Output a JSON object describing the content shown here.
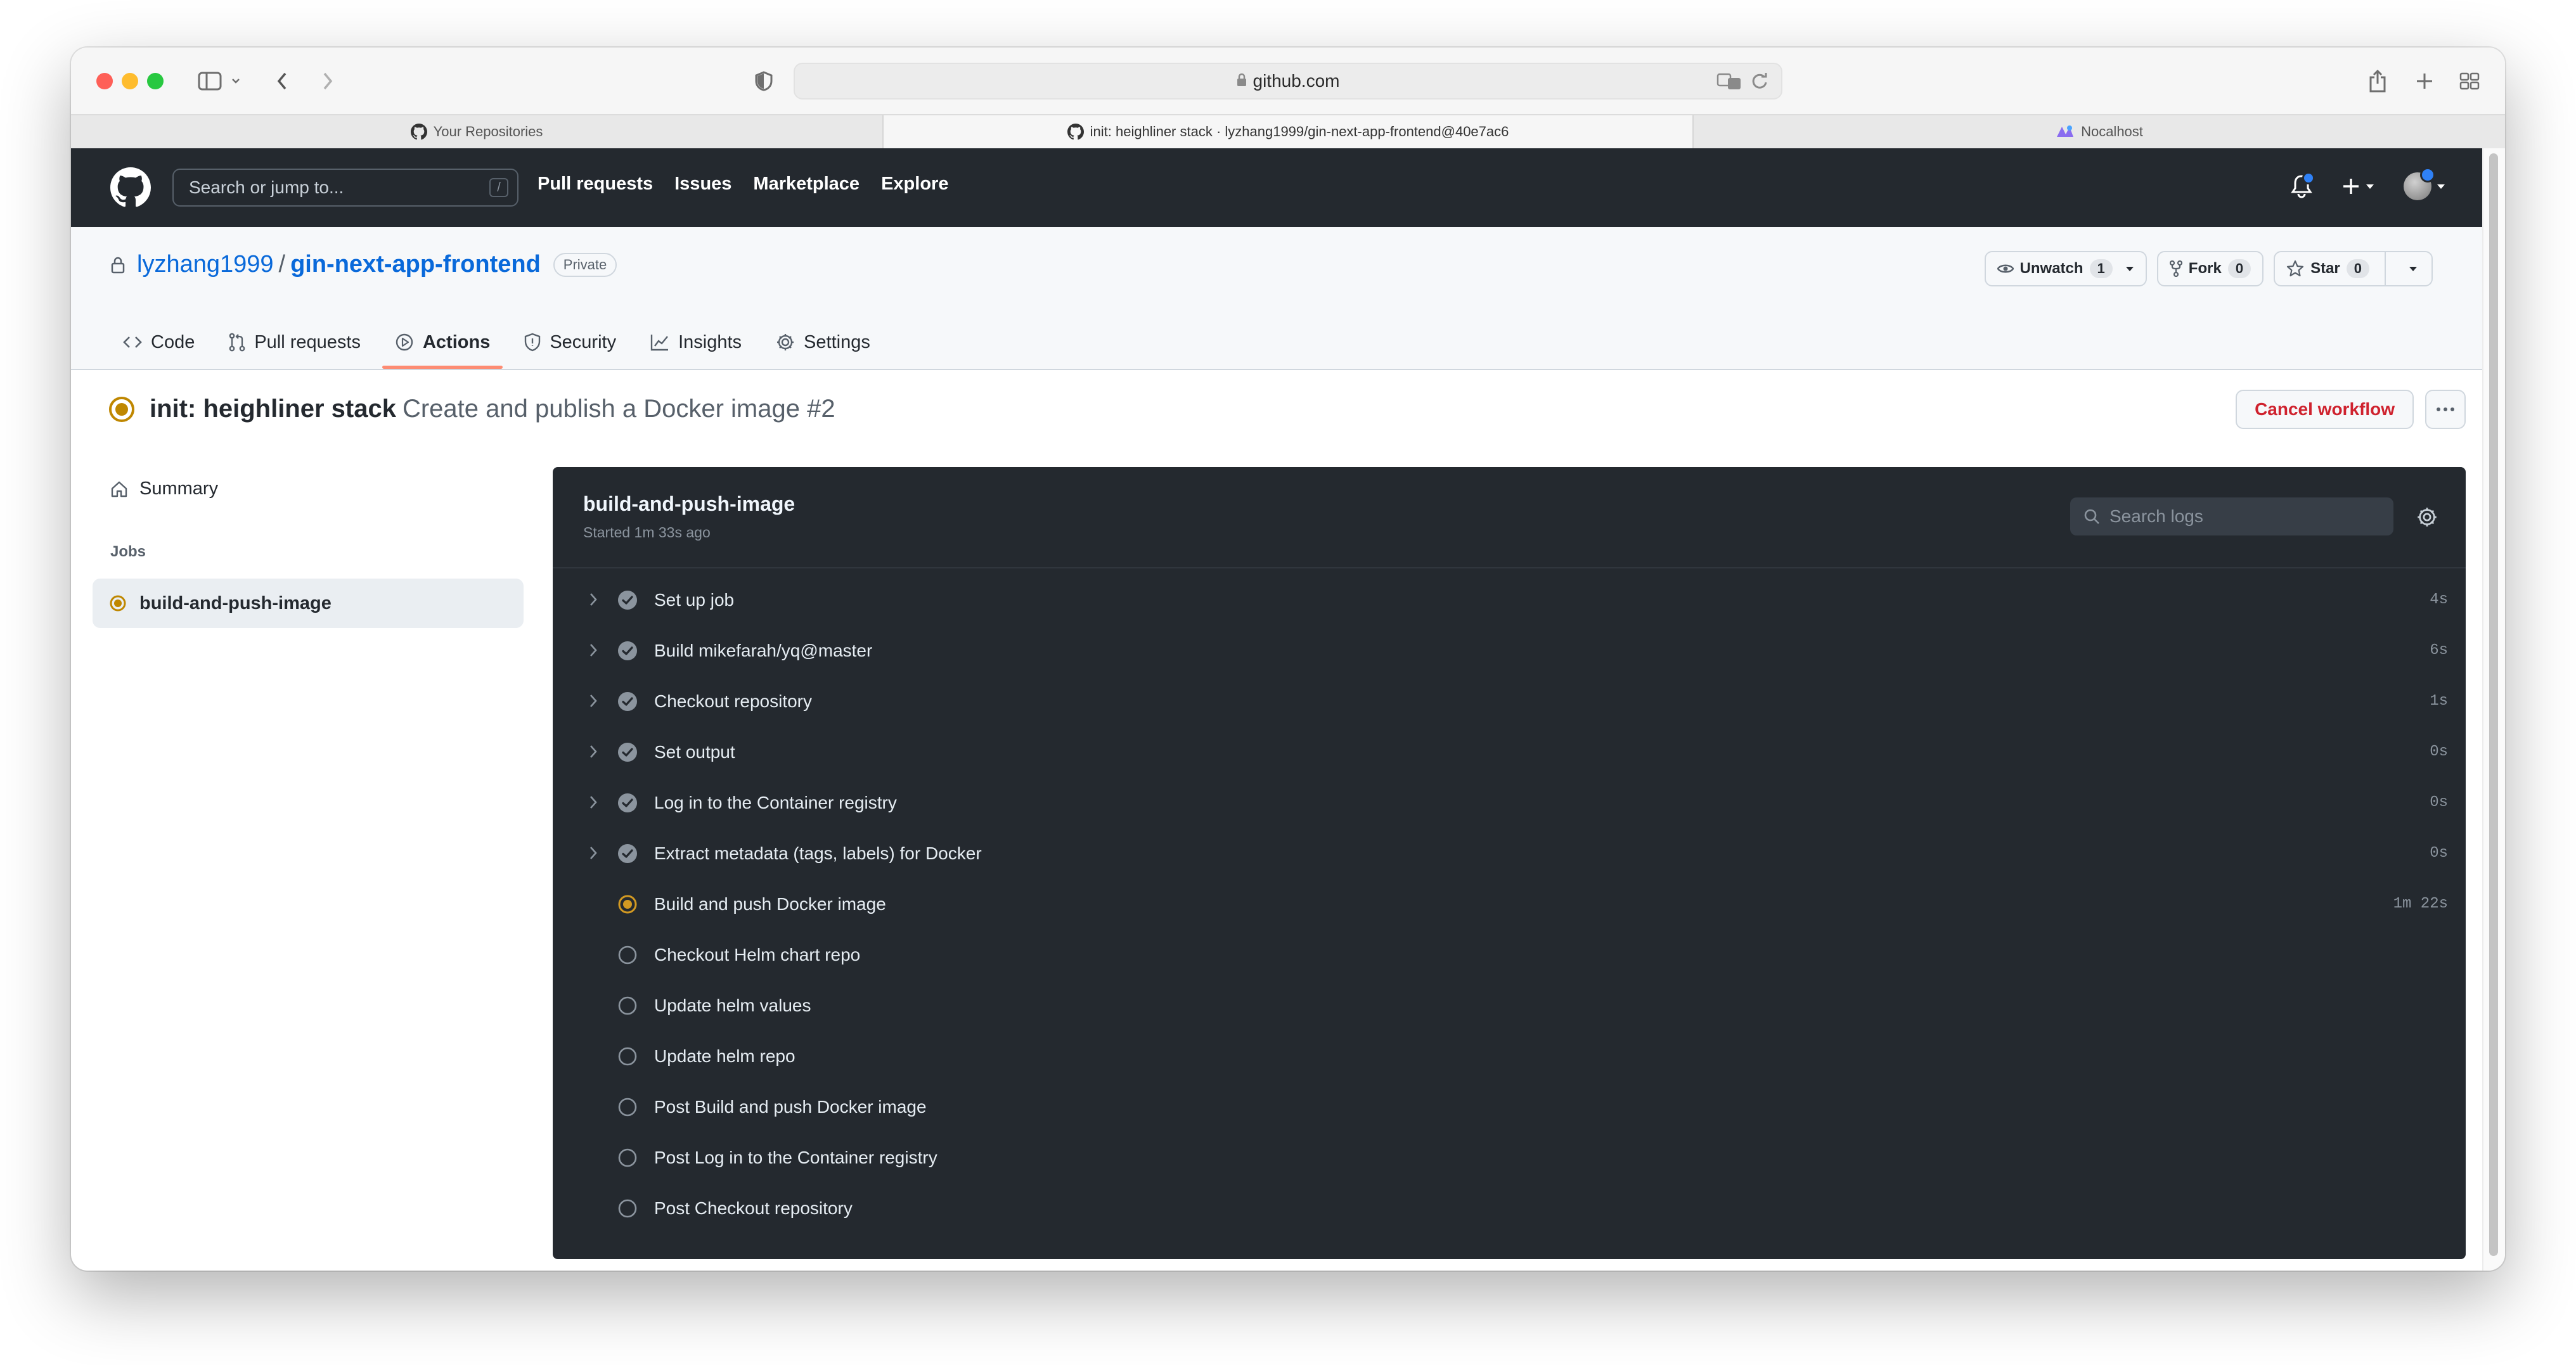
{
  "browser": {
    "url": "github.com",
    "tabs": [
      {
        "label": "Your Repositories"
      },
      {
        "label": "init: heighliner stack · lyzhang1999/gin-next-app-frontend@40e7ac6"
      },
      {
        "label": "Nocalhost"
      }
    ]
  },
  "github": {
    "search_placeholder": "Search or jump to...",
    "search_shortcut": "/",
    "nav": [
      "Pull requests",
      "Issues",
      "Marketplace",
      "Explore"
    ]
  },
  "repo": {
    "owner": "lyzhang1999",
    "separator": "/",
    "name": "gin-next-app-frontend",
    "visibility": "Private",
    "unwatch_label": "Unwatch",
    "unwatch_count": "1",
    "fork_label": "Fork",
    "fork_count": "0",
    "star_label": "Star",
    "star_count": "0",
    "tabs": [
      {
        "label": "Code",
        "icon": "code-icon"
      },
      {
        "label": "Pull requests",
        "icon": "pull-request-icon"
      },
      {
        "label": "Actions",
        "icon": "play-icon",
        "active": true
      },
      {
        "label": "Security",
        "icon": "shield-icon"
      },
      {
        "label": "Insights",
        "icon": "graph-icon"
      },
      {
        "label": "Settings",
        "icon": "gear-icon"
      }
    ]
  },
  "run": {
    "title_bold": "init: heighliner stack",
    "title_light": "Create and publish a Docker image #2",
    "cancel_label": "Cancel workflow",
    "status_color": "#bf8700"
  },
  "sidebar": {
    "summary_label": "Summary",
    "jobs_heading": "Jobs",
    "job_label": "build-and-push-image"
  },
  "log": {
    "title": "build-and-push-image",
    "started": "Started 1m 33s ago",
    "search_placeholder": "Search logs",
    "steps": [
      {
        "label": "Set up job",
        "status": "success",
        "duration": "4s"
      },
      {
        "label": "Build mikefarah/yq@master",
        "status": "success",
        "duration": "6s"
      },
      {
        "label": "Checkout repository",
        "status": "success",
        "duration": "1s"
      },
      {
        "label": "Set output",
        "status": "success",
        "duration": "0s"
      },
      {
        "label": "Log in to the Container registry",
        "status": "success",
        "duration": "0s"
      },
      {
        "label": "Extract metadata (tags, labels) for Docker",
        "status": "success",
        "duration": "0s"
      },
      {
        "label": "Build and push Docker image",
        "status": "in_progress",
        "duration": "1m 22s"
      },
      {
        "label": "Checkout Helm chart repo",
        "status": "queued",
        "duration": ""
      },
      {
        "label": "Update helm values",
        "status": "queued",
        "duration": ""
      },
      {
        "label": "Update helm repo",
        "status": "queued",
        "duration": ""
      },
      {
        "label": "Post Build and push Docker image",
        "status": "queued",
        "duration": ""
      },
      {
        "label": "Post Log in to the Container registry",
        "status": "queued",
        "duration": ""
      },
      {
        "label": "Post Checkout repository",
        "status": "queued",
        "duration": ""
      }
    ]
  }
}
